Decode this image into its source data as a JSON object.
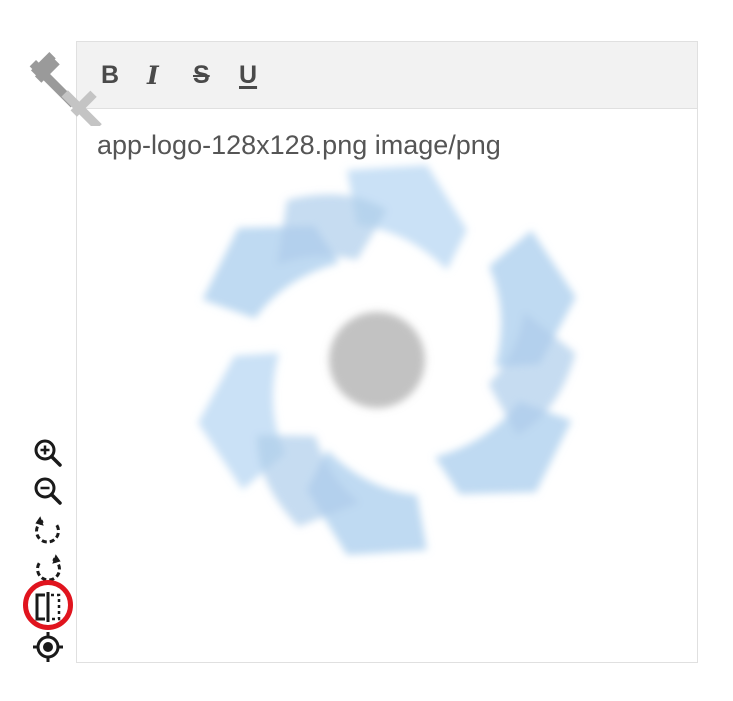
{
  "toolbar": {
    "bold_label": "B",
    "italic_label": "I",
    "strike_label": "S",
    "underline_label": "U"
  },
  "content": {
    "file_info": "app-logo-128x128.png image/png"
  },
  "side_tools": [
    {
      "name": "zoom-in-icon"
    },
    {
      "name": "zoom-out-icon"
    },
    {
      "name": "rotate-left-icon"
    },
    {
      "name": "rotate-right-icon"
    },
    {
      "name": "flip-horizontal-icon"
    },
    {
      "name": "center-focus-icon"
    }
  ],
  "colors": {
    "toolbar_bg": "#f2f2f2",
    "text": "#555555",
    "icon": "#1a1a1a",
    "watermark_blue": "#bcd8f2",
    "watermark_gray": "#c2c2c2",
    "highlight": "#e0141e"
  }
}
